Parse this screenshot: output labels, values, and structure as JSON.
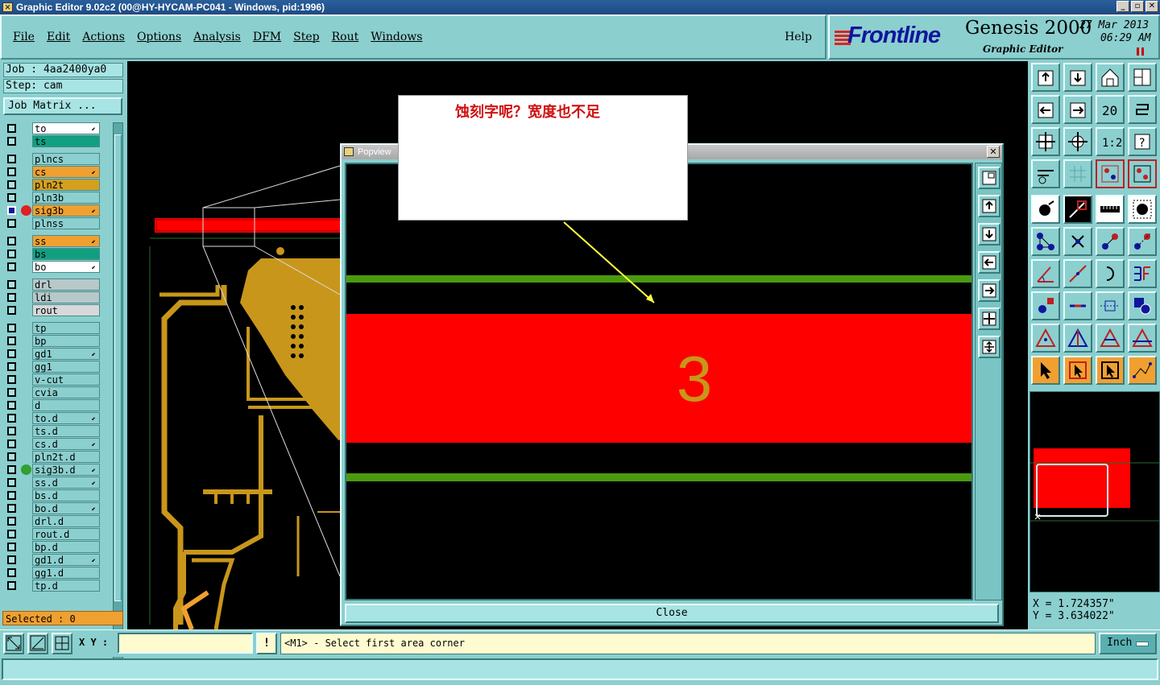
{
  "window": {
    "title": "Graphic Editor 9.02c2 (00@HY-HYCAM-PC041 - Windows, pid:1996)"
  },
  "menu": {
    "items": [
      "File",
      "Edit",
      "Actions",
      "Options",
      "Analysis",
      "DFM",
      "Step",
      "Rout",
      "Windows"
    ],
    "help": "Help"
  },
  "brand": {
    "logo": "Frontline",
    "product": "Genesis 2000",
    "subtitle": "Graphic Editor",
    "date": "27 Mar 2013",
    "time": "06:29 AM"
  },
  "job": {
    "job": "Job : 4aa2400ya0",
    "step": "Step: cam",
    "matrix_button": "Job Matrix ..."
  },
  "layers": [
    {
      "name": "to",
      "color": "#ffffff",
      "arrow": true
    },
    {
      "name": "ts",
      "color": "#10a080",
      "arrow": false
    },
    {
      "name": "plncs",
      "color": "#8ccfcf",
      "arrow": false
    },
    {
      "name": "cs",
      "color": "#f0a030",
      "arrow": true
    },
    {
      "name": "pln2t",
      "color": "#d4a020",
      "arrow": false
    },
    {
      "name": "pln3b",
      "color": "#8ccfcf",
      "arrow": false
    },
    {
      "name": "sig3b",
      "color": "#f0a030",
      "arrow": true,
      "active": true,
      "dot": "#e02020"
    },
    {
      "name": "plnss",
      "color": "#8ccfcf",
      "arrow": false
    },
    {
      "name": "ss",
      "color": "#f0a030",
      "arrow": true
    },
    {
      "name": "bs",
      "color": "#10a080",
      "arrow": false
    },
    {
      "name": "bo",
      "color": "#ffffff",
      "arrow": true
    },
    {
      "name": "drl",
      "color": "#b8c8c8",
      "arrow": false
    },
    {
      "name": "ldi",
      "color": "#b8c8c8",
      "arrow": false
    },
    {
      "name": "rout",
      "color": "#d8d8d8",
      "arrow": false
    },
    {
      "name": "tp",
      "color": "#8ccfcf",
      "arrow": false
    },
    {
      "name": "bp",
      "color": "#8ccfcf",
      "arrow": false
    },
    {
      "name": "gd1",
      "color": "#8ccfcf",
      "arrow": true
    },
    {
      "name": "gg1",
      "color": "#8ccfcf",
      "arrow": false
    },
    {
      "name": "v-cut",
      "color": "#8ccfcf",
      "arrow": false
    },
    {
      "name": "cvia",
      "color": "#8ccfcf",
      "arrow": false
    },
    {
      "name": "d",
      "color": "#8ccfcf",
      "arrow": false
    },
    {
      "name": "to.d",
      "color": "#8ccfcf",
      "arrow": true
    },
    {
      "name": "ts.d",
      "color": "#8ccfcf",
      "arrow": false
    },
    {
      "name": "cs.d",
      "color": "#8ccfcf",
      "arrow": true
    },
    {
      "name": "pln2t.d",
      "color": "#8ccfcf",
      "arrow": false
    },
    {
      "name": "sig3b.d",
      "color": "#8ccfcf",
      "arrow": true,
      "dot": "#30a030"
    },
    {
      "name": "ss.d",
      "color": "#8ccfcf",
      "arrow": true
    },
    {
      "name": "bs.d",
      "color": "#8ccfcf",
      "arrow": false
    },
    {
      "name": "bo.d",
      "color": "#8ccfcf",
      "arrow": true
    },
    {
      "name": "drl.d",
      "color": "#8ccfcf",
      "arrow": false
    },
    {
      "name": "rout.d",
      "color": "#8ccfcf",
      "arrow": false
    },
    {
      "name": "bp.d",
      "color": "#8ccfcf",
      "arrow": false
    },
    {
      "name": "gd1.d",
      "color": "#8ccfcf",
      "arrow": true
    },
    {
      "name": "gg1.d",
      "color": "#8ccfcf",
      "arrow": false
    },
    {
      "name": "tp.d",
      "color": "#8ccfcf",
      "arrow": false
    }
  ],
  "selected": "Selected : 0",
  "popview": {
    "title": "Popview",
    "close_label": "Close",
    "feature_text": "3"
  },
  "callout": {
    "text": "蚀刻字呢？宽度也不足"
  },
  "coords": {
    "x": "X = 1.724357\"",
    "y": "Y = 3.634022\""
  },
  "bottom": {
    "xy_label": "X Y :",
    "xy_value": "",
    "warn": "!",
    "prompt": "<M1> - Select first area corner",
    "unit": "Inch"
  },
  "colors": {
    "bg": "#8ccfcf",
    "copper": "#c8961a",
    "red_feature": "#ff0000",
    "green_line": "#4a9a10"
  }
}
